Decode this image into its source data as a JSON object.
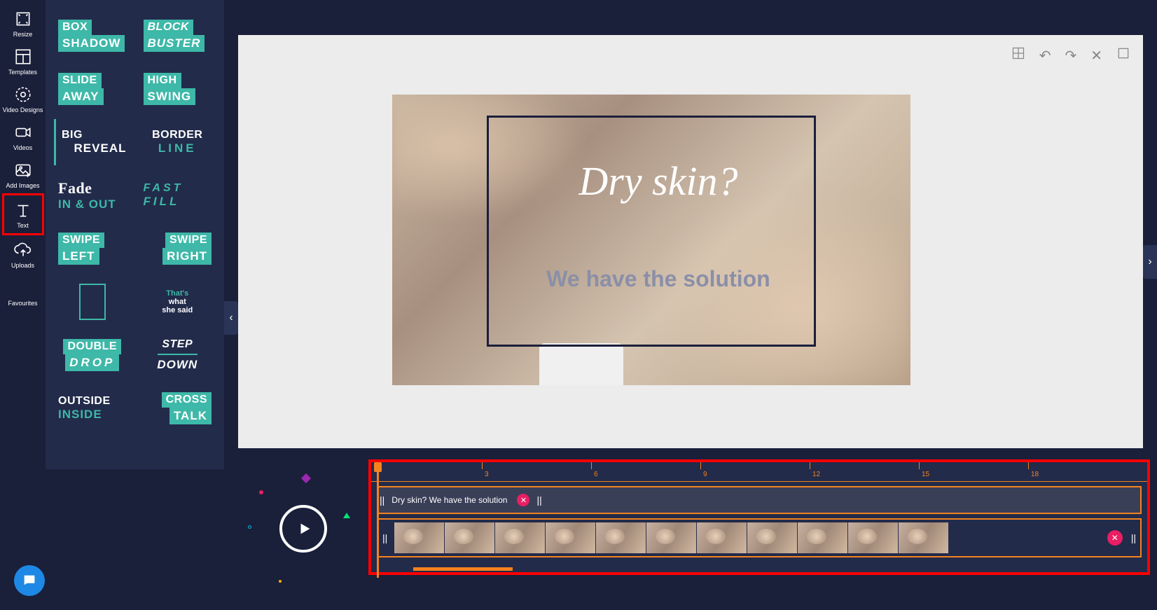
{
  "nav": {
    "resize": "Resize",
    "templates": "Templates",
    "video_designs": "Video Designs",
    "videos": "Videos",
    "add_images": "Add Images",
    "text": "Text",
    "uploads": "Uploads",
    "favourites": "Favourites"
  },
  "templates": [
    {
      "l1": "BOX",
      "l2": "SHADOW"
    },
    {
      "l1": "BLOCK",
      "l2": "BUSTER"
    },
    {
      "l1": "SLIDE",
      "l2": "AWAY"
    },
    {
      "l1": "HIGH",
      "l2": "SWING"
    },
    {
      "l1": "BIG",
      "l2": "REVEAL"
    },
    {
      "l1": "BORDER",
      "l2": "LINE"
    },
    {
      "l1": "Fade",
      "l2": "IN & OUT"
    },
    {
      "l1": "FAST",
      "l2": "FILL"
    },
    {
      "l1": "SWIPE",
      "l2": "LEFT"
    },
    {
      "l1": "SWIPE",
      "l2": "RIGHT"
    },
    {
      "l1": "",
      "l2": ""
    },
    {
      "l1": "That's",
      "l2": "what",
      "l3": "she said"
    },
    {
      "l1": "DOUBLE",
      "l2": "DROP"
    },
    {
      "l1": "STEP",
      "l2": "DOWN"
    },
    {
      "l1": "OUTSIDE",
      "l2": "INSIDE"
    },
    {
      "l1": "CROSS",
      "l2": "TALK"
    }
  ],
  "canvas": {
    "title": "Dry skin?",
    "subtitle": "We have the solution"
  },
  "timeline": {
    "ticks": [
      "3",
      "6",
      "9",
      "12",
      "15",
      "18"
    ],
    "clip_label": "Dry skin? We have the solution",
    "thumb_count": 11
  }
}
